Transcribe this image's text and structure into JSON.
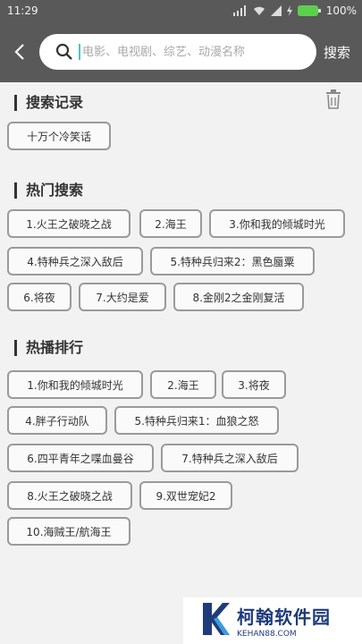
{
  "status_bar": {
    "time": "11:29",
    "battery": "100%"
  },
  "search": {
    "placeholder": "电影、电视剧、综艺、动漫名称",
    "submit_label": "搜索"
  },
  "history": {
    "title": "搜索记录",
    "items": [
      "十万个冷笑话"
    ]
  },
  "hot_search": {
    "title": "热门搜索",
    "items": [
      "1.火王之破晓之战",
      "2.海王",
      "3.你和我的倾城时光",
      "4.特种兵之深入敌后",
      "5.特种兵归来2：黑色蜃粟",
      "6.将夜",
      "7.大约是爱",
      "8.金刚2之金刚复活"
    ]
  },
  "hot_play": {
    "title": "热播排行",
    "items": [
      "1.你和我的倾城时光",
      "2.海王",
      "3.将夜",
      "4.胖子行动队",
      "5.特种兵归来1：血狼之怒",
      "6.四平青年之喋血曼谷",
      "7.特种兵之深入敌后",
      "8.火王之破晓之战",
      "9.双世宠妃2",
      "10.海贼王/航海王"
    ]
  },
  "watermark": {
    "name": "柯翰软件园",
    "url": "KEHAN88.COM"
  },
  "colors": {
    "header_bg": "#595959",
    "page_bg": "#f2f2f2",
    "tag_border": "#9a9a9a",
    "cursor": "#4fc2c6",
    "battery": "#5ccf4f",
    "brand": "#1f3b7a"
  }
}
